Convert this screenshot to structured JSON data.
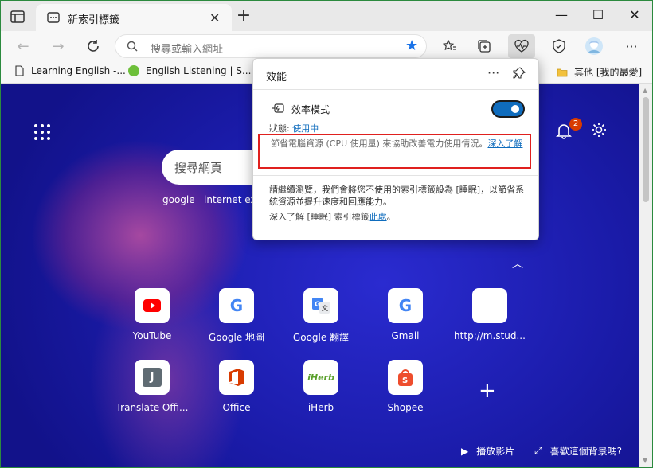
{
  "tab": {
    "title": "新索引標籤"
  },
  "address": {
    "placeholder": "搜尋或輸入網址"
  },
  "bookmarks": [
    {
      "label": "Learning English -..."
    },
    {
      "label": "English Listening | S..."
    },
    {
      "label": "其他 [我的最愛]"
    }
  ],
  "newtab": {
    "search_placeholder": "搜尋網頁",
    "quick_links": [
      "google",
      "internet exp"
    ],
    "notification_count": "2",
    "tiles": [
      {
        "label": "YouTube",
        "icon": "youtube-icon",
        "color": "#ff0000"
      },
      {
        "label": "Google 地圖",
        "icon": "google-icon",
        "glyph": "G"
      },
      {
        "label": "Google 翻譯",
        "icon": "google-translate-icon",
        "glyph": "G"
      },
      {
        "label": "Gmail",
        "icon": "google-icon",
        "glyph": "G"
      },
      {
        "label": "http://m.stud...",
        "icon": "blank-icon",
        "glyph": ""
      },
      {
        "label": "Translate Offi...",
        "icon": "translate-office-icon",
        "glyph": "J"
      },
      {
        "label": "Office",
        "icon": "office-icon",
        "glyph": "O"
      },
      {
        "label": "iHerb",
        "icon": "iherb-icon",
        "glyph": "iHerb"
      },
      {
        "label": "Shopee",
        "icon": "shopee-icon",
        "glyph": "S"
      }
    ],
    "play_video": "播放影片",
    "like_background": "喜歡這個背景嗎?"
  },
  "flyout": {
    "title": "效能",
    "mode_label": "效率模式",
    "status_label": "狀態: ",
    "status_value": "使用中",
    "description": "節省電腦資源 (CPU 使用量) 來協助改善電力使用情況。",
    "learn_more": "深入了解",
    "sleep_description": "請繼續瀏覽，我們會將您不使用的索引標籤設為 [睡眠]，以節省系統資源並提升速度和回應能力。",
    "sleep_learn_prefix": "深入了解 [睡眠] 索引標籤",
    "sleep_learn_link": "此處",
    "sleep_learn_suffix": "。"
  },
  "colors": {
    "accent": "#0f6cbd",
    "highlight": "#e0201e",
    "arrow": "#e8141b"
  }
}
